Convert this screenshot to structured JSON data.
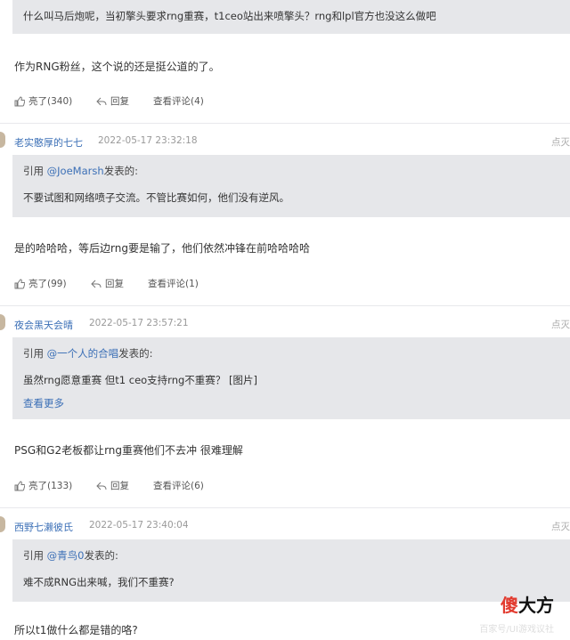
{
  "comment_top": {
    "quote_line": "什么叫马后炮呢，当初擎头要求rng重赛，t1ceo站出来喷擎头？rng和lpl官方也没这么做吧",
    "text": "作为RNG粉丝，这个说的还是挺公道的了。",
    "likes": "亮了(340)",
    "reply": "回复",
    "view": "查看评论(4)"
  },
  "comments": [
    {
      "user": "老实憨厚的七七",
      "time": "2022-05-17 23:32:18",
      "more": "点灭",
      "quote_prefix": "引用 ",
      "quote_mention": "@JoeMarsh",
      "quote_suffix": "发表的:",
      "quote_text": "不要试图和网络喷子交流。不管比赛如何，他们没有逆风。",
      "text": "是的哈哈哈，等后边rng要是输了，他们依然冲锋在前哈哈哈哈",
      "likes": "亮了(99)",
      "reply": "回复",
      "view": "查看评论(1)"
    },
    {
      "user": "夜会黑天会晴",
      "time": "2022-05-17 23:57:21",
      "more": "点灭",
      "quote_prefix": "引用 ",
      "quote_mention": "@一个人的合唱",
      "quote_suffix": "发表的:",
      "quote_text": "虽然rng愿意重赛 但t1 ceo支持rng不重赛？ [图片]",
      "see_more": "查看更多",
      "text": "PSG和G2老板都让rng重赛他们不去冲 很难理解",
      "likes": "亮了(133)",
      "reply": "回复",
      "view": "查看评论(6)"
    },
    {
      "user": "西野七濑彼氏",
      "time": "2022-05-17 23:40:04",
      "more": "点灭",
      "quote_prefix": "引用 ",
      "quote_mention": "@青鸟0",
      "quote_suffix": "发表的:",
      "quote_text": "难不成RNG出来喊，我们不重赛?",
      "text": "所以t1做什么都是错的咯?"
    }
  ],
  "watermark": {
    "red": "傻",
    "black": "大方",
    "sub": "百家号/UI游戏议社"
  },
  "colors": {
    "link": "#3b6fb6",
    "quote_bg": "#e6e7ea",
    "watermark_red": "#e23b2f"
  }
}
